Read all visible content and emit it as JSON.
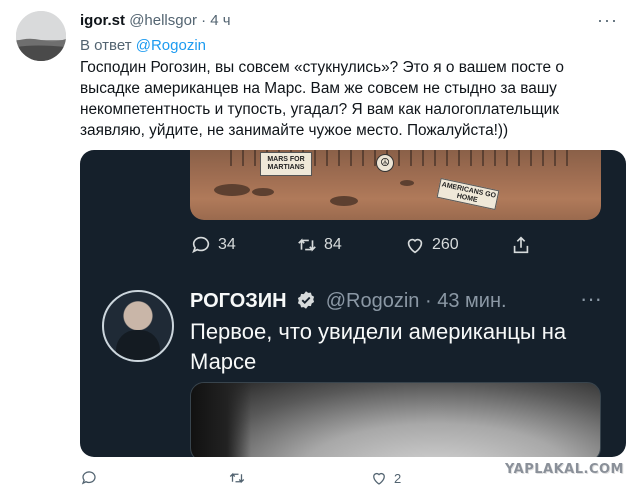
{
  "tweet": {
    "author_name": "igor.st",
    "author_handle": "@hellsgor",
    "separator": "·",
    "time": "4 ч",
    "reply_prefix": "В ответ",
    "reply_mention": "@Rogozin",
    "text": "Господин Рогозин, вы совсем «стукнулись»? Это я о вашем посте о высадке американцев на Марс. Вам же совсем не стыдно за вашу некомпетентность и тупость, угадал? Я вам как налогоплательщик заявляю, уйдите, не занимайте чужое место. Пожалуйста!))",
    "actions": {
      "replies": "",
      "retweets": "",
      "likes": "2"
    }
  },
  "embedded": {
    "image_signs": {
      "sign1": "MARS FOR MARTIANS",
      "sign2": "AMERICANS GO HOME"
    },
    "actions": {
      "replies": "34",
      "retweets": "84",
      "likes": "260"
    },
    "reply": {
      "name": "РОГОЗИН",
      "handle": "@Rogozin",
      "separator": "·",
      "time": "43 мин.",
      "text": "Первое, что увидели американцы на Марсе"
    }
  },
  "watermark": "YAPLAKAL.COM",
  "colors": {
    "link": "#1d9bf0",
    "dark_bg": "#15202b",
    "verified": "#1d9bf0"
  }
}
